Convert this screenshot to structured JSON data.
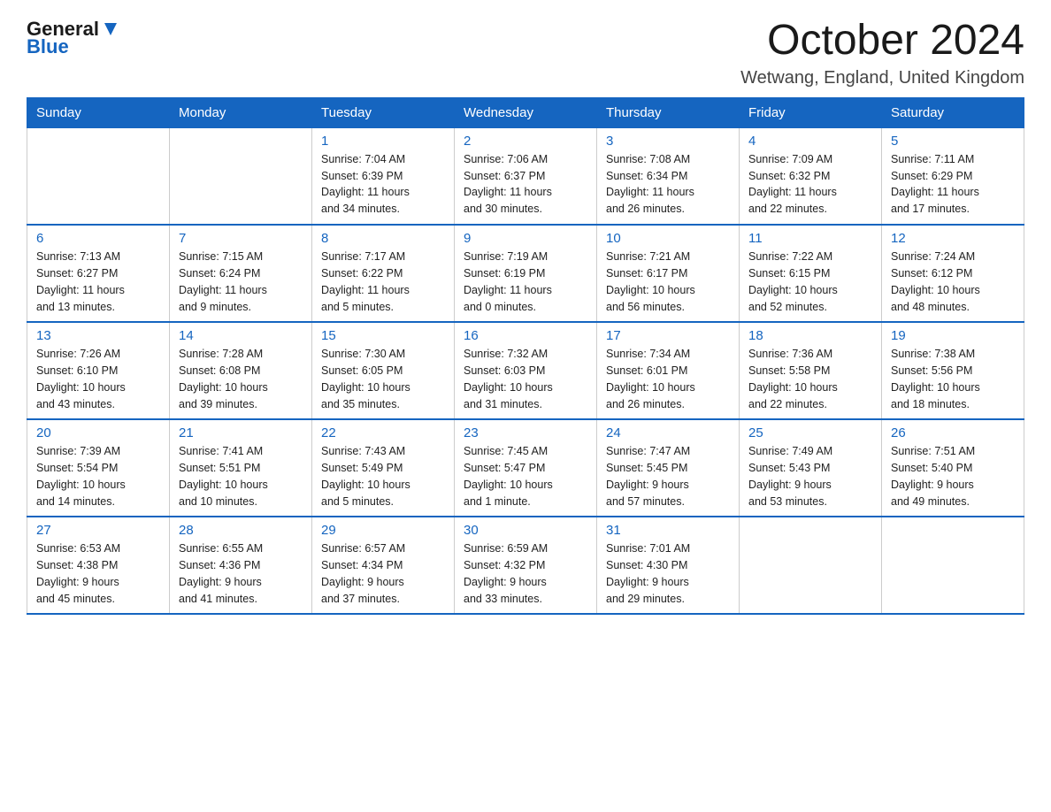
{
  "header": {
    "logo_general": "General",
    "logo_blue": "Blue",
    "title": "October 2024",
    "location": "Wetwang, England, United Kingdom"
  },
  "calendar": {
    "days_of_week": [
      "Sunday",
      "Monday",
      "Tuesday",
      "Wednesday",
      "Thursday",
      "Friday",
      "Saturday"
    ],
    "weeks": [
      [
        {
          "day": "",
          "info": ""
        },
        {
          "day": "",
          "info": ""
        },
        {
          "day": "1",
          "info": "Sunrise: 7:04 AM\nSunset: 6:39 PM\nDaylight: 11 hours\nand 34 minutes."
        },
        {
          "day": "2",
          "info": "Sunrise: 7:06 AM\nSunset: 6:37 PM\nDaylight: 11 hours\nand 30 minutes."
        },
        {
          "day": "3",
          "info": "Sunrise: 7:08 AM\nSunset: 6:34 PM\nDaylight: 11 hours\nand 26 minutes."
        },
        {
          "day": "4",
          "info": "Sunrise: 7:09 AM\nSunset: 6:32 PM\nDaylight: 11 hours\nand 22 minutes."
        },
        {
          "day": "5",
          "info": "Sunrise: 7:11 AM\nSunset: 6:29 PM\nDaylight: 11 hours\nand 17 minutes."
        }
      ],
      [
        {
          "day": "6",
          "info": "Sunrise: 7:13 AM\nSunset: 6:27 PM\nDaylight: 11 hours\nand 13 minutes."
        },
        {
          "day": "7",
          "info": "Sunrise: 7:15 AM\nSunset: 6:24 PM\nDaylight: 11 hours\nand 9 minutes."
        },
        {
          "day": "8",
          "info": "Sunrise: 7:17 AM\nSunset: 6:22 PM\nDaylight: 11 hours\nand 5 minutes."
        },
        {
          "day": "9",
          "info": "Sunrise: 7:19 AM\nSunset: 6:19 PM\nDaylight: 11 hours\nand 0 minutes."
        },
        {
          "day": "10",
          "info": "Sunrise: 7:21 AM\nSunset: 6:17 PM\nDaylight: 10 hours\nand 56 minutes."
        },
        {
          "day": "11",
          "info": "Sunrise: 7:22 AM\nSunset: 6:15 PM\nDaylight: 10 hours\nand 52 minutes."
        },
        {
          "day": "12",
          "info": "Sunrise: 7:24 AM\nSunset: 6:12 PM\nDaylight: 10 hours\nand 48 minutes."
        }
      ],
      [
        {
          "day": "13",
          "info": "Sunrise: 7:26 AM\nSunset: 6:10 PM\nDaylight: 10 hours\nand 43 minutes."
        },
        {
          "day": "14",
          "info": "Sunrise: 7:28 AM\nSunset: 6:08 PM\nDaylight: 10 hours\nand 39 minutes."
        },
        {
          "day": "15",
          "info": "Sunrise: 7:30 AM\nSunset: 6:05 PM\nDaylight: 10 hours\nand 35 minutes."
        },
        {
          "day": "16",
          "info": "Sunrise: 7:32 AM\nSunset: 6:03 PM\nDaylight: 10 hours\nand 31 minutes."
        },
        {
          "day": "17",
          "info": "Sunrise: 7:34 AM\nSunset: 6:01 PM\nDaylight: 10 hours\nand 26 minutes."
        },
        {
          "day": "18",
          "info": "Sunrise: 7:36 AM\nSunset: 5:58 PM\nDaylight: 10 hours\nand 22 minutes."
        },
        {
          "day": "19",
          "info": "Sunrise: 7:38 AM\nSunset: 5:56 PM\nDaylight: 10 hours\nand 18 minutes."
        }
      ],
      [
        {
          "day": "20",
          "info": "Sunrise: 7:39 AM\nSunset: 5:54 PM\nDaylight: 10 hours\nand 14 minutes."
        },
        {
          "day": "21",
          "info": "Sunrise: 7:41 AM\nSunset: 5:51 PM\nDaylight: 10 hours\nand 10 minutes."
        },
        {
          "day": "22",
          "info": "Sunrise: 7:43 AM\nSunset: 5:49 PM\nDaylight: 10 hours\nand 5 minutes."
        },
        {
          "day": "23",
          "info": "Sunrise: 7:45 AM\nSunset: 5:47 PM\nDaylight: 10 hours\nand 1 minute."
        },
        {
          "day": "24",
          "info": "Sunrise: 7:47 AM\nSunset: 5:45 PM\nDaylight: 9 hours\nand 57 minutes."
        },
        {
          "day": "25",
          "info": "Sunrise: 7:49 AM\nSunset: 5:43 PM\nDaylight: 9 hours\nand 53 minutes."
        },
        {
          "day": "26",
          "info": "Sunrise: 7:51 AM\nSunset: 5:40 PM\nDaylight: 9 hours\nand 49 minutes."
        }
      ],
      [
        {
          "day": "27",
          "info": "Sunrise: 6:53 AM\nSunset: 4:38 PM\nDaylight: 9 hours\nand 45 minutes."
        },
        {
          "day": "28",
          "info": "Sunrise: 6:55 AM\nSunset: 4:36 PM\nDaylight: 9 hours\nand 41 minutes."
        },
        {
          "day": "29",
          "info": "Sunrise: 6:57 AM\nSunset: 4:34 PM\nDaylight: 9 hours\nand 37 minutes."
        },
        {
          "day": "30",
          "info": "Sunrise: 6:59 AM\nSunset: 4:32 PM\nDaylight: 9 hours\nand 33 minutes."
        },
        {
          "day": "31",
          "info": "Sunrise: 7:01 AM\nSunset: 4:30 PM\nDaylight: 9 hours\nand 29 minutes."
        },
        {
          "day": "",
          "info": ""
        },
        {
          "day": "",
          "info": ""
        }
      ]
    ]
  }
}
